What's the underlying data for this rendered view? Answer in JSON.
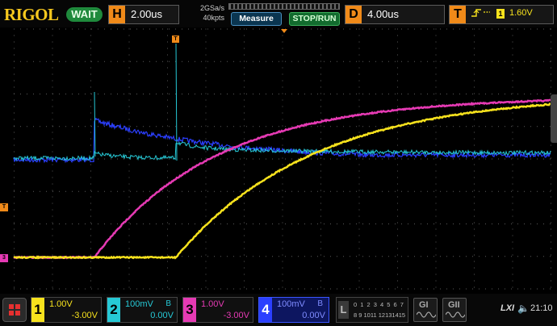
{
  "header": {
    "brand": "RIGOL",
    "run_status": "WAIT",
    "horizontal": {
      "key": "H",
      "value": "2.00us"
    },
    "sample_rate": "2GSa/s",
    "memory_depth": "40kpts",
    "measure_label": "Measure",
    "stop_run_label": "STOP/RUN",
    "delay": {
      "key": "D",
      "value": "4.00us"
    },
    "trigger": {
      "key": "T",
      "channel": "1",
      "level": "1.60V"
    }
  },
  "markers": {
    "trigger_pos": "T",
    "ch3": "3"
  },
  "waveform_colors": {
    "ch1": "#f7e21d",
    "ch2": "#26c9d6",
    "ch3": "#e63ab4",
    "ch4": "#2b3fff"
  },
  "channels": [
    {
      "number": "1",
      "scale": "1.00V",
      "offset": "-3.00V",
      "bw": "",
      "color": "#f7e21d"
    },
    {
      "number": "2",
      "scale": "100mV",
      "offset": "0.00V",
      "bw": "B",
      "color": "#26c9d6"
    },
    {
      "number": "3",
      "scale": "1.00V",
      "offset": "-3.00V",
      "bw": "",
      "color": "#e63ab4"
    },
    {
      "number": "4",
      "scale": "100mV",
      "offset": "0.00V",
      "bw": "B",
      "color": "#2b3fff"
    }
  ],
  "logic": {
    "key": "L",
    "row1": "0 1 2 3 4 5 6 7",
    "row2": "8 9 1011 12131415"
  },
  "generators": [
    {
      "label": "GI"
    },
    {
      "label": "GII"
    }
  ],
  "system": {
    "lxi": "LXI",
    "time": "21:10"
  }
}
